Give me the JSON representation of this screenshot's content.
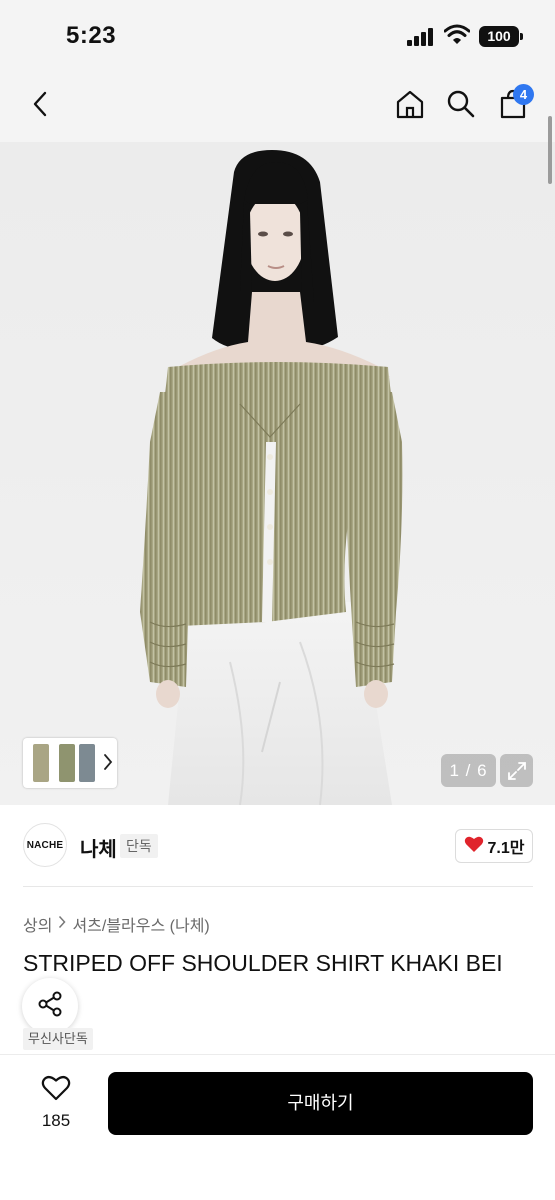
{
  "status_bar": {
    "time": "5:23",
    "battery": "100"
  },
  "nav": {
    "cart_count": "4"
  },
  "gallery": {
    "counter": "1 / 6"
  },
  "brand": {
    "logo_text": "NACHE",
    "name": "나체",
    "tag": "단독",
    "likes": "7.1만"
  },
  "product": {
    "breadcrumb": [
      "상의",
      "셔츠/블라우스 (나체)"
    ],
    "title": "STRIPED OFF SHOULDER SHIRT KHAKI BEI",
    "exclusive_badge": "무신사단독"
  },
  "bottom": {
    "wish_count": "185",
    "buy_label": "구매하기"
  },
  "colors": {
    "accent_blue": "#2f77f0",
    "heart_red": "#e0242c",
    "buy_bg": "#000000"
  },
  "icons": [
    "back-icon",
    "home-icon",
    "search-icon",
    "cart-icon",
    "chevron-right-icon",
    "expand-icon",
    "heart-icon",
    "share-icon"
  ]
}
